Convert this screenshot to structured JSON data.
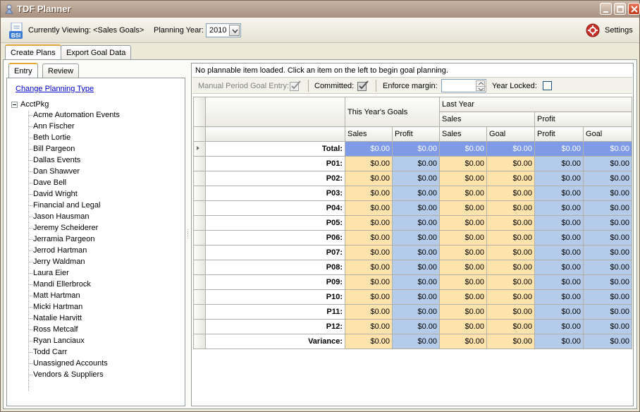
{
  "window": {
    "title": "TDF Planner"
  },
  "toolbar": {
    "viewing_label": "Currently Viewing: <Sales Goals>",
    "year_label": "Planning Year:",
    "year_value": "2010",
    "settings_label": "Settings"
  },
  "main_tabs": [
    {
      "label": "Create Plans"
    },
    {
      "label": "Export Goal Data"
    }
  ],
  "sub_tabs": [
    {
      "label": "Entry"
    },
    {
      "label": "Review"
    }
  ],
  "left": {
    "change_type_link": "Change Planning Type",
    "root": "AcctPkg",
    "items": [
      "Acme Automation Events",
      "Ann Fischer",
      "Beth Lortie",
      "Bill Pargeon",
      "Dallas Events",
      "Dan Shawver",
      "Dave Bell",
      "David Wright",
      "Financial and Legal",
      "Jason Hausman",
      "Jeremy Scheiderer",
      "Jerramia Pargeon",
      "Jerrod Hartman",
      "Jerry Waldman",
      "Laura Eier",
      "Mandi Ellerbrock",
      "Matt Hartman",
      "Micki Hartman",
      "Natalie Harvitt",
      "Ross Metcalf",
      "Ryan Lanciaux",
      "Todd Carr",
      "Unassigned Accounts",
      "Vendors & Suppliers"
    ]
  },
  "right": {
    "status": "No plannable item loaded. Click an item on the left to begin goal planning.",
    "options": {
      "manual": "Manual Period Goal Entry:",
      "committed": "Committed:",
      "margin": "Enforce margin:",
      "margin_value": "",
      "locked": "Year Locked:"
    }
  },
  "grid": {
    "group_this_year": "This Year's Goals",
    "group_last_year": "Last Year",
    "sub_sales": "Sales",
    "sub_profit": "Profit",
    "columns": [
      "Sales",
      "Profit",
      "Sales",
      "Goal",
      "Profit",
      "Goal"
    ],
    "rows": [
      {
        "label": "Total:",
        "values": [
          "$0.00",
          "$0.00",
          "$0.00",
          "$0.00",
          "$0.00",
          "$0.00"
        ]
      },
      {
        "label": "P01:",
        "values": [
          "$0.00",
          "$0.00",
          "$0.00",
          "$0.00",
          "$0.00",
          "$0.00"
        ]
      },
      {
        "label": "P02:",
        "values": [
          "$0.00",
          "$0.00",
          "$0.00",
          "$0.00",
          "$0.00",
          "$0.00"
        ]
      },
      {
        "label": "P03:",
        "values": [
          "$0.00",
          "$0.00",
          "$0.00",
          "$0.00",
          "$0.00",
          "$0.00"
        ]
      },
      {
        "label": "P04:",
        "values": [
          "$0.00",
          "$0.00",
          "$0.00",
          "$0.00",
          "$0.00",
          "$0.00"
        ]
      },
      {
        "label": "P05:",
        "values": [
          "$0.00",
          "$0.00",
          "$0.00",
          "$0.00",
          "$0.00",
          "$0.00"
        ]
      },
      {
        "label": "P06:",
        "values": [
          "$0.00",
          "$0.00",
          "$0.00",
          "$0.00",
          "$0.00",
          "$0.00"
        ]
      },
      {
        "label": "P07:",
        "values": [
          "$0.00",
          "$0.00",
          "$0.00",
          "$0.00",
          "$0.00",
          "$0.00"
        ]
      },
      {
        "label": "P08:",
        "values": [
          "$0.00",
          "$0.00",
          "$0.00",
          "$0.00",
          "$0.00",
          "$0.00"
        ]
      },
      {
        "label": "P09:",
        "values": [
          "$0.00",
          "$0.00",
          "$0.00",
          "$0.00",
          "$0.00",
          "$0.00"
        ]
      },
      {
        "label": "P10:",
        "values": [
          "$0.00",
          "$0.00",
          "$0.00",
          "$0.00",
          "$0.00",
          "$0.00"
        ]
      },
      {
        "label": "P11:",
        "values": [
          "$0.00",
          "$0.00",
          "$0.00",
          "$0.00",
          "$0.00",
          "$0.00"
        ]
      },
      {
        "label": "P12:",
        "values": [
          "$0.00",
          "$0.00",
          "$0.00",
          "$0.00",
          "$0.00",
          "$0.00"
        ]
      },
      {
        "label": "Variance:",
        "values": [
          "$0.00",
          "$0.00",
          "$0.00",
          "$0.00",
          "$0.00",
          "$0.00"
        ]
      }
    ]
  },
  "colors": {
    "tan": "#ffe3ac",
    "blue": "#b4cbea",
    "total": "#7f9be8",
    "titlebar": "#a89080"
  }
}
